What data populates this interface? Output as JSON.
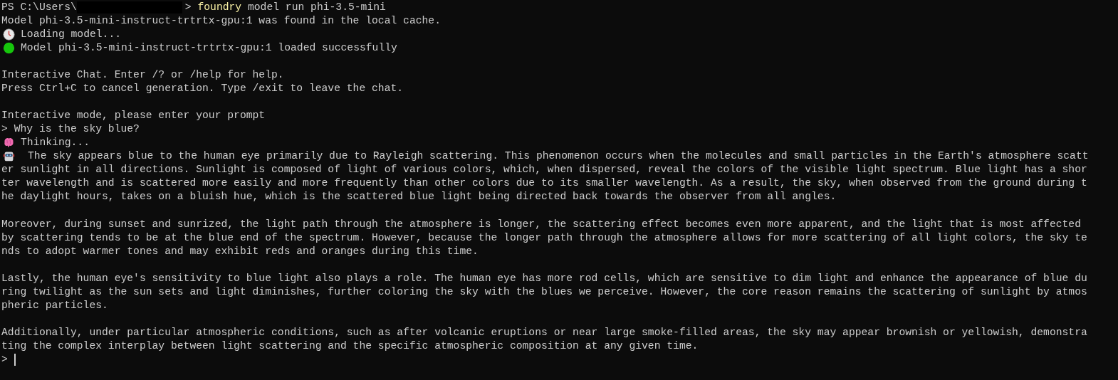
{
  "terminal": {
    "lines": [
      {
        "kind": "command",
        "prompt": "PS C:\\Users\\",
        "redacted": true,
        "prompt_end": ">",
        "command": "foundry",
        "args": "model run phi-3.5-mini"
      },
      {
        "kind": "text",
        "text": "Model phi-3.5-mini-instruct-trtrtx-gpu:1 was found in the local cache."
      },
      {
        "kind": "loading",
        "text": "Loading model..."
      },
      {
        "kind": "success",
        "text": "Model phi-3.5-mini-instruct-trtrtx-gpu:1 loaded successfully"
      },
      {
        "kind": "blank"
      },
      {
        "kind": "text",
        "text": "Interactive Chat. Enter /? or /help for help."
      },
      {
        "kind": "text",
        "text": "Press Ctrl+C to cancel generation. Type /exit to leave the chat."
      },
      {
        "kind": "blank"
      },
      {
        "kind": "text",
        "text": "Interactive mode, please enter your prompt"
      },
      {
        "kind": "text",
        "text": "> Why is the sky blue?"
      },
      {
        "kind": "thinking",
        "text": "Thinking..."
      },
      {
        "kind": "reply",
        "text": "The sky appears blue to the human eye primarily due to Rayleigh scattering. This phenomenon occurs when the molecules and small particles in the Earth's atmosphere scatt"
      },
      {
        "kind": "text",
        "text": "er sunlight in all directions. Sunlight is composed of light of various colors, which, when dispersed, reveal the colors of the visible light spectrum. Blue light has a shor"
      },
      {
        "kind": "text",
        "text": "ter wavelength and is scattered more easily and more frequently than other colors due to its smaller wavelength. As a result, the sky, when observed from the ground during t"
      },
      {
        "kind": "text",
        "text": "he daylight hours, takes on a bluish hue, which is the scattered blue light being directed back towards the observer from all angles."
      },
      {
        "kind": "blank"
      },
      {
        "kind": "text",
        "text": "Moreover, during sunset and sunrized, the light path through the atmosphere is longer, the scattering effect becomes even more apparent, and the light that is most affected"
      },
      {
        "kind": "text",
        "text": "by scattering tends to be at the blue end of the spectrum. However, because the longer path through the atmosphere allows for more scattering of all light colors, the sky te"
      },
      {
        "kind": "text",
        "text": "nds to adopt warmer tones and may exhibit reds and oranges during this time."
      },
      {
        "kind": "blank"
      },
      {
        "kind": "text",
        "text": "Lastly, the human eye's sensitivity to blue light also plays a role. The human eye has more rod cells, which are sensitive to dim light and enhance the appearance of blue du"
      },
      {
        "kind": "text",
        "text": "ring twilight as the sun sets and light diminishes, further coloring the sky with the blues we perceive. However, the core reason remains the scattering of sunlight by atmos"
      },
      {
        "kind": "text",
        "text": "pheric particles."
      },
      {
        "kind": "blank"
      },
      {
        "kind": "text",
        "text": "Additionally, under particular atmospheric conditions, such as after volcanic eruptions or near large smoke-filled areas, the sky may appear brownish or yellowish, demonstra"
      },
      {
        "kind": "text",
        "text": "ting the complex interplay between light scattering and the specific atmospheric composition at any given time."
      },
      {
        "kind": "input",
        "prompt": ">",
        "cursor": true
      }
    ]
  }
}
